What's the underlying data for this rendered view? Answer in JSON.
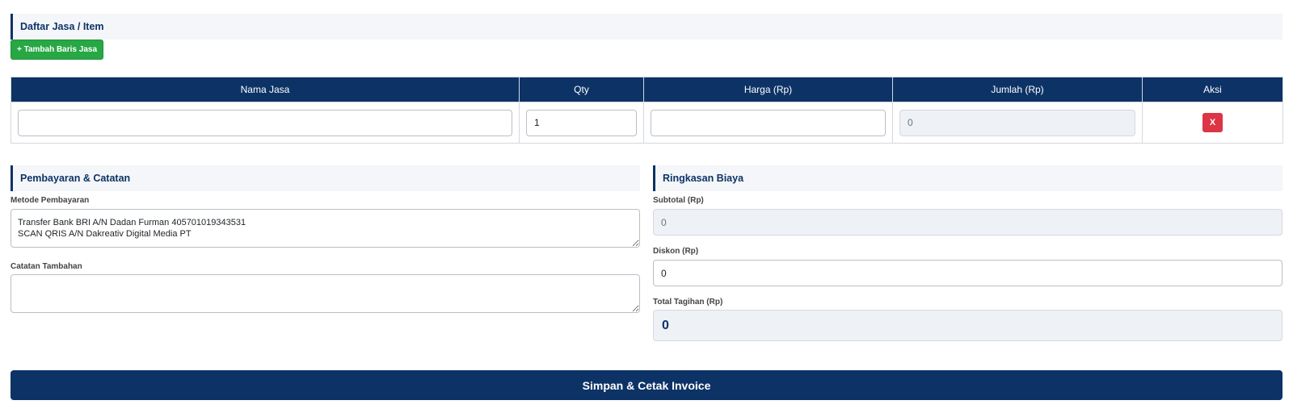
{
  "items_section": {
    "title": "Daftar Jasa / Item",
    "add_button": "+ Tambah Baris Jasa",
    "columns": [
      "Nama Jasa",
      "Qty",
      "Harga (Rp)",
      "Jumlah (Rp)",
      "Aksi"
    ],
    "rows": [
      {
        "nama": "",
        "qty": "1",
        "harga": "",
        "jumlah": "0",
        "delete_label": "X"
      }
    ]
  },
  "payment_section": {
    "title": "Pembayaran & Catatan",
    "method_label": "Metode Pembayaran",
    "method_value": "Transfer Bank BRI A/N Dadan Furman 405701019343531\nSCAN QRIS A/N Dakreativ Digital Media PT",
    "notes_label": "Catatan Tambahan",
    "notes_value": ""
  },
  "summary_section": {
    "title": "Ringkasan Biaya",
    "subtotal_label": "Subtotal (Rp)",
    "subtotal_value": "0",
    "discount_label": "Diskon (Rp)",
    "discount_value": "0",
    "total_label": "Total Tagihan (Rp)",
    "total_value": "0"
  },
  "submit_button": "Simpan & Cetak Invoice",
  "colors": {
    "primary": "#0d3366",
    "success": "#28a745",
    "danger": "#dc3545",
    "readonly_bg": "#eef1f5",
    "header_bg": "#f4f6f9"
  }
}
